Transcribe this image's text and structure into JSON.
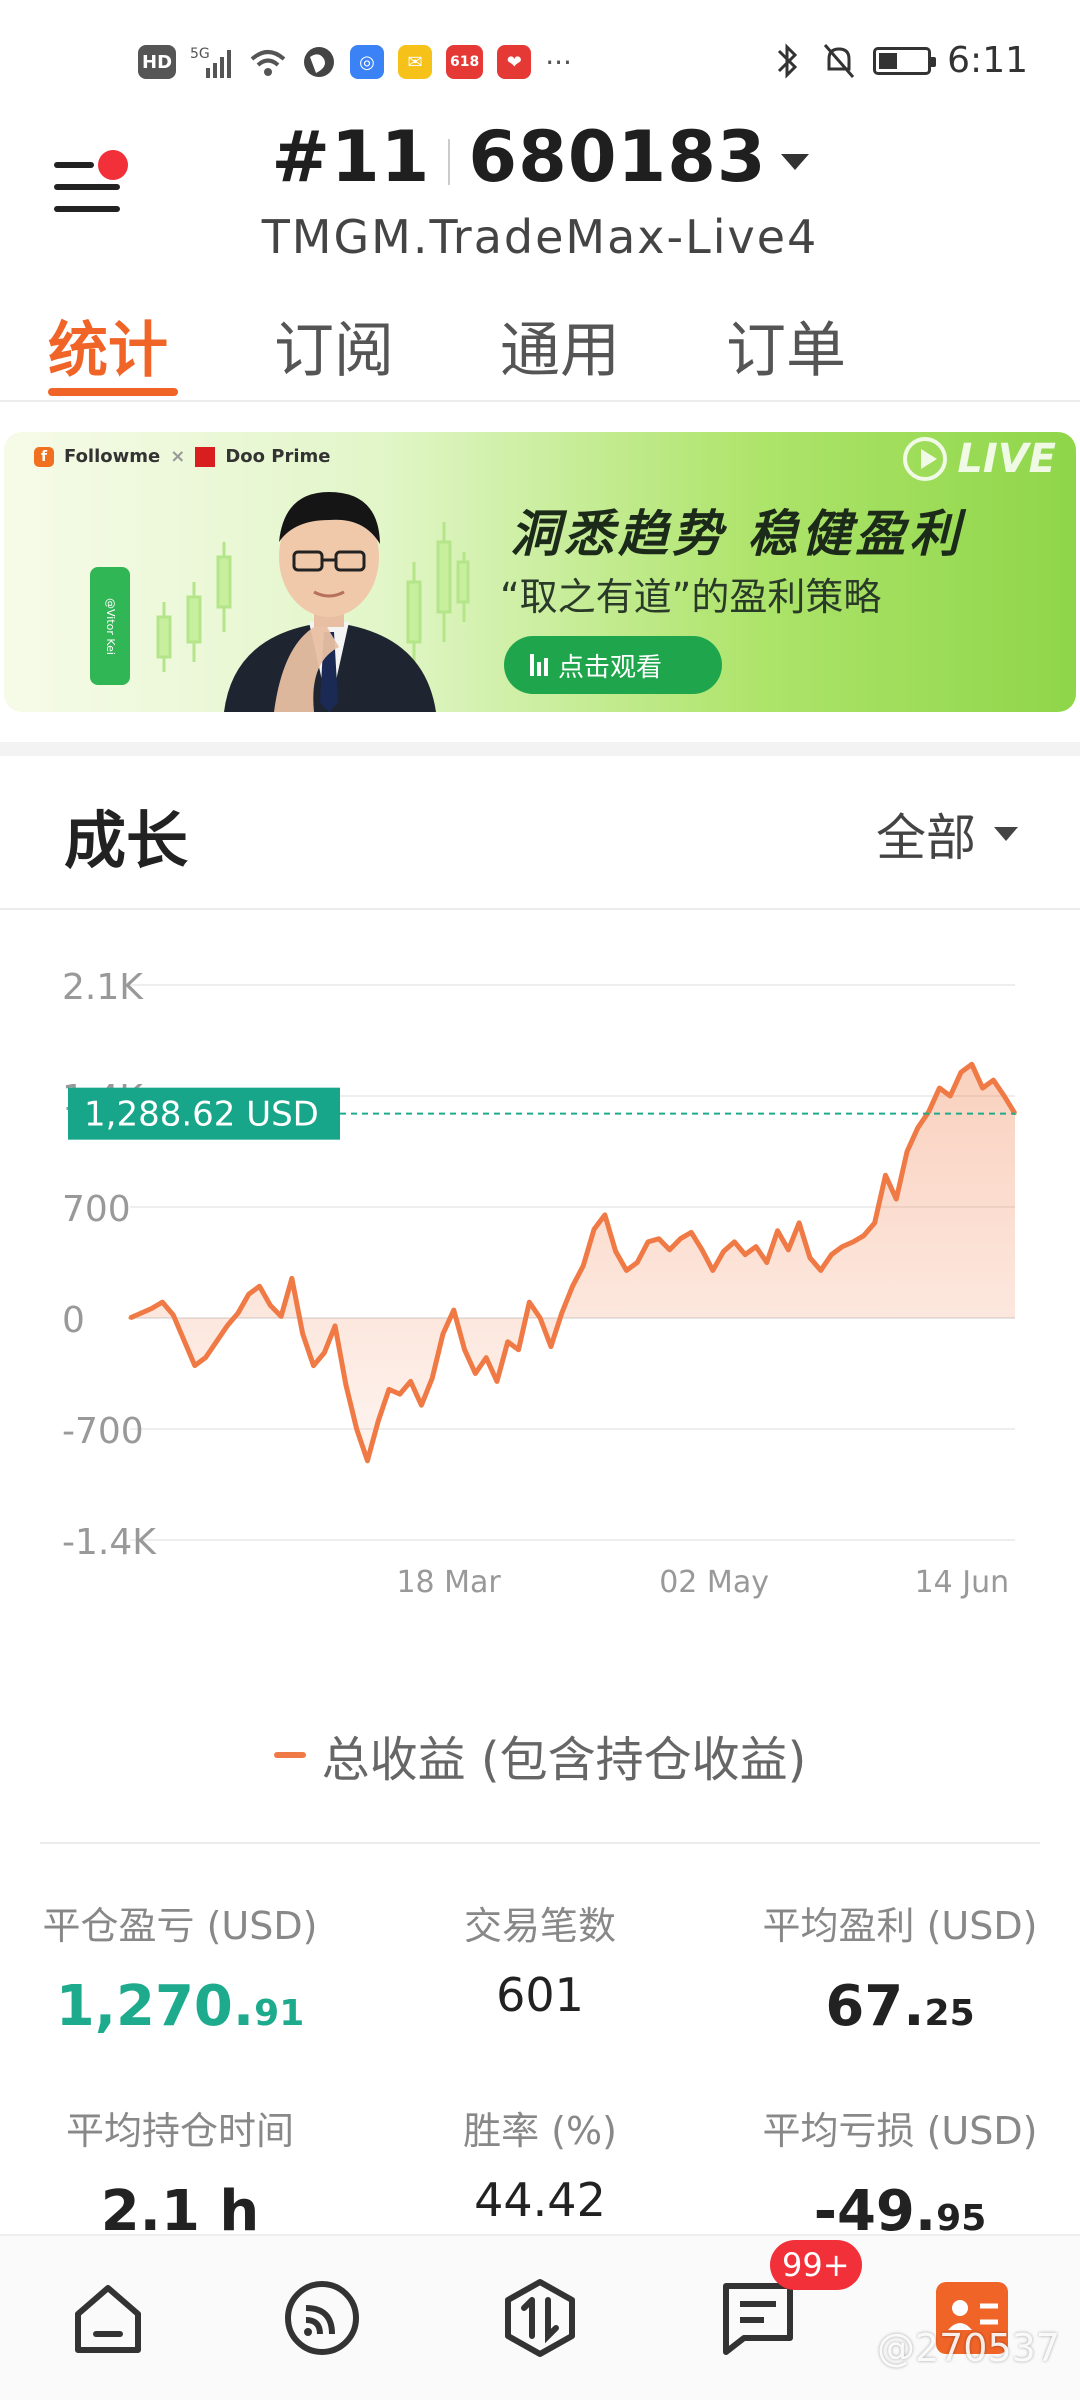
{
  "status_bar": {
    "left_icons": [
      "hd-icon",
      "5g-signal-icon",
      "wifi-icon",
      "globe-icon",
      "browser-icon",
      "mail-icon",
      "618-icon",
      "heart-app-icon",
      "more-icon"
    ],
    "hd": "HD",
    "more": "···",
    "time": "6:11"
  },
  "header": {
    "account_rank": "#11",
    "account_id": "680183",
    "server": "TMGM.TradeMax-Live4"
  },
  "tabs": [
    {
      "label": "统计",
      "active": true
    },
    {
      "label": "订阅",
      "active": false
    },
    {
      "label": "通用",
      "active": false
    },
    {
      "label": "订单",
      "active": false
    }
  ],
  "banner": {
    "brand_left": "Followme",
    "brand_right": "Doo Prime",
    "side_label": "@Vitor Kei",
    "live": "LIVE",
    "headline": "洞悉趋势 稳健盈利",
    "subline": "“取之有道”的盈利策略",
    "button": "点击观看"
  },
  "growth": {
    "title": "成长",
    "range": "全部"
  },
  "chart_data": {
    "type": "area",
    "y_ticks": [
      "2.1K",
      "1.4K",
      "700",
      "0",
      "-700",
      "-1.4K"
    ],
    "ylim": [
      -1400,
      2100
    ],
    "x_ticks": [
      "18 Mar",
      "02 May",
      "14 Jun"
    ],
    "current_label": "1,288.62 USD",
    "current_value": 1288.62,
    "series": [
      {
        "name": "总收益 (包含持仓收益)",
        "color": "#f07a45",
        "values": [
          0,
          30,
          60,
          100,
          20,
          -140,
          -300,
          -250,
          -150,
          -50,
          30,
          150,
          200,
          80,
          10,
          250,
          -100,
          -300,
          -220,
          -50,
          -420,
          -700,
          -900,
          -650,
          -450,
          -480,
          -400,
          -550,
          -380,
          -100,
          50,
          -200,
          -350,
          -250,
          -400,
          -150,
          -200,
          100,
          0,
          -180,
          30,
          200,
          330,
          560,
          650,
          420,
          300,
          350,
          480,
          500,
          430,
          500,
          540,
          430,
          300,
          420,
          480,
          400,
          450,
          350,
          550,
          430,
          600,
          380,
          300,
          400,
          450,
          480,
          520,
          600,
          900,
          750,
          1050,
          1200,
          1300,
          1450,
          1400,
          1550,
          1600,
          1450,
          1500,
          1400,
          1288.62
        ]
      }
    ],
    "legend": "总收益 (包含持仓收益)"
  },
  "stats": [
    {
      "label": "平仓盈亏 (USD)",
      "int": "1,270.",
      "dec": "91",
      "color": "green"
    },
    {
      "label": "交易笔数",
      "int": "601",
      "dec": "",
      "color": "plain"
    },
    {
      "label": "平均盈利 (USD)",
      "int": "67.",
      "dec": "25",
      "color": "dark"
    },
    {
      "label": "平均持仓时间",
      "int": "2.1 h",
      "dec": "",
      "color": "dark"
    },
    {
      "label": "胜率 (%)",
      "int": "44.42",
      "dec": "",
      "color": "plain"
    },
    {
      "label": "平均亏损 (USD)",
      "int": "-49.",
      "dec": "95",
      "color": "dark"
    }
  ],
  "bottom_nav": {
    "items": [
      "home-icon",
      "feed-icon",
      "trade-icon",
      "messages-icon",
      "profile-icon"
    ],
    "badge": "99+",
    "watermark": "@270537"
  }
}
